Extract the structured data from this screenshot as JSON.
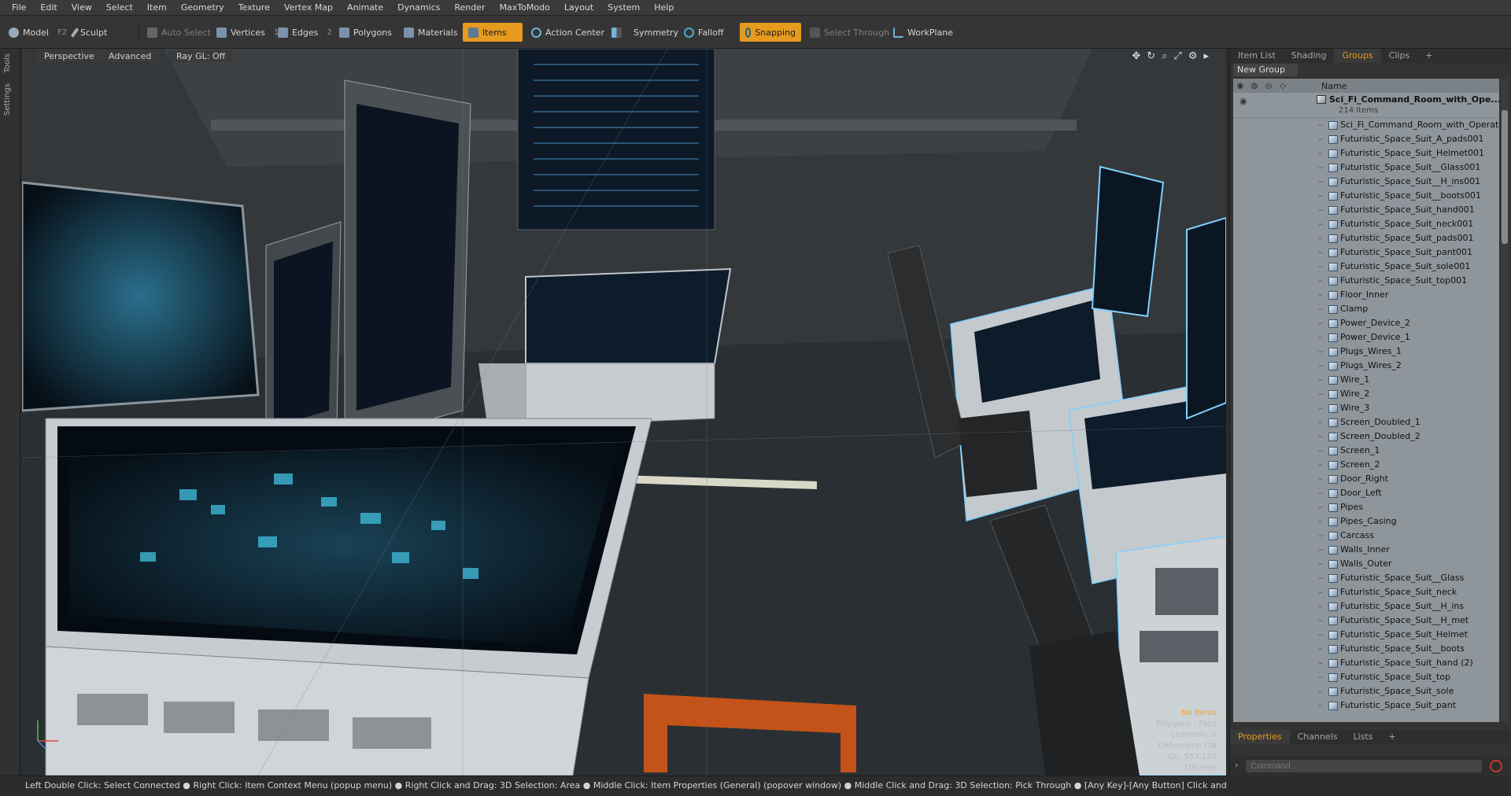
{
  "menu": [
    "File",
    "Edit",
    "View",
    "Select",
    "Item",
    "Geometry",
    "Texture",
    "Vertex Map",
    "Animate",
    "Dynamics",
    "Render",
    "MaxToModo",
    "Layout",
    "System",
    "Help"
  ],
  "toolbar": {
    "model": "Model",
    "model_key": "F2",
    "sculpt": "Sculpt",
    "auto_select": "Auto Select",
    "vertices": "Vertices",
    "vertices_key": "1",
    "edges": "Edges",
    "edges_key": "2",
    "polygons": "Polygons",
    "materials": "Materials",
    "items": "Items",
    "action_center": "Action Center",
    "symmetry": "Symmetry",
    "falloff": "Falloff",
    "snapping": "Snapping",
    "select_through": "Select Through",
    "workplane": "WorkPlane"
  },
  "leftstrip": {
    "tools": "Tools",
    "settings": "Settings"
  },
  "viewport": {
    "tabs": [
      "Perspective",
      "Advanced",
      "Ray GL: Off"
    ],
    "info": {
      "no_items": "No Items",
      "polygons": "Polygons : Face",
      "channels": "Channels: 0",
      "deformers": "Deformers: ON",
      "gl": "GL: 553,152",
      "scale": "100 mm"
    }
  },
  "rightpanel": {
    "tabs": [
      "Item List",
      "Shading",
      "Groups",
      "Clips",
      "+"
    ],
    "new_group": "New Group",
    "col_name": "Name",
    "root": {
      "name": "Sci_Fi_Command_Room_with_Ope...",
      "count": "214 Items"
    },
    "items": [
      "Sci_Fi_Command_Room_with_Operat ...",
      "Futuristic_Space_Suit_A_pads001",
      "Futuristic_Space_Suit_Helmet001",
      "Futuristic_Space_Suit__Glass001",
      "Futuristic_Space_Suit__H_ins001",
      "Futuristic_Space_Suit__boots001",
      "Futuristic_Space_Suit_hand001",
      "Futuristic_Space_Suit_neck001",
      "Futuristic_Space_Suit_pads001",
      "Futuristic_Space_Suit_pant001",
      "Futuristic_Space_Suit_sole001",
      "Futuristic_Space_Suit_top001",
      "Floor_Inner",
      "Clamp",
      "Power_Device_2",
      "Power_Device_1",
      "Plugs_Wires_1",
      "Plugs_Wires_2",
      "Wire_1",
      "Wire_2",
      "Wire_3",
      "Screen_Doubled_1",
      "Screen_Doubled_2",
      "Screen_1",
      "Screen_2",
      "Door_Right",
      "Door_Left",
      "Pipes",
      "Pipes_Casing",
      "Carcass",
      "Walls_Inner",
      "Walls_Outer",
      "Futuristic_Space_Suit__Glass",
      "Futuristic_Space_Suit_neck",
      "Futuristic_Space_Suit__H_ins",
      "Futuristic_Space_Suit__H_met",
      "Futuristic_Space_Suit_Helmet",
      "Futuristic_Space_Suit__boots",
      "Futuristic_Space_Suit_hand (2)",
      "Futuristic_Space_Suit_top",
      "Futuristic_Space_Suit_sole",
      "Futuristic_Space_Suit_pant"
    ],
    "bottom_tabs": [
      "Properties",
      "Channels",
      "Lists",
      "+"
    ],
    "command_placeholder": "Command"
  },
  "status": "Left Double Click: Select Connected ● Right Click: Item Context Menu (popup menu) ● Right Click and Drag: 3D Selection: Area ● Middle Click: Item Properties (General) (popover window) ● Middle Click and Drag: 3D Selection: Pick Through ● [Any Key]-[Any Button] Click and Drag: dragDropBegin",
  "colors": {
    "accent": "#e69a1e",
    "screen_glow": "#4fb7d8",
    "wire_highlight": "#7fd0ff"
  }
}
